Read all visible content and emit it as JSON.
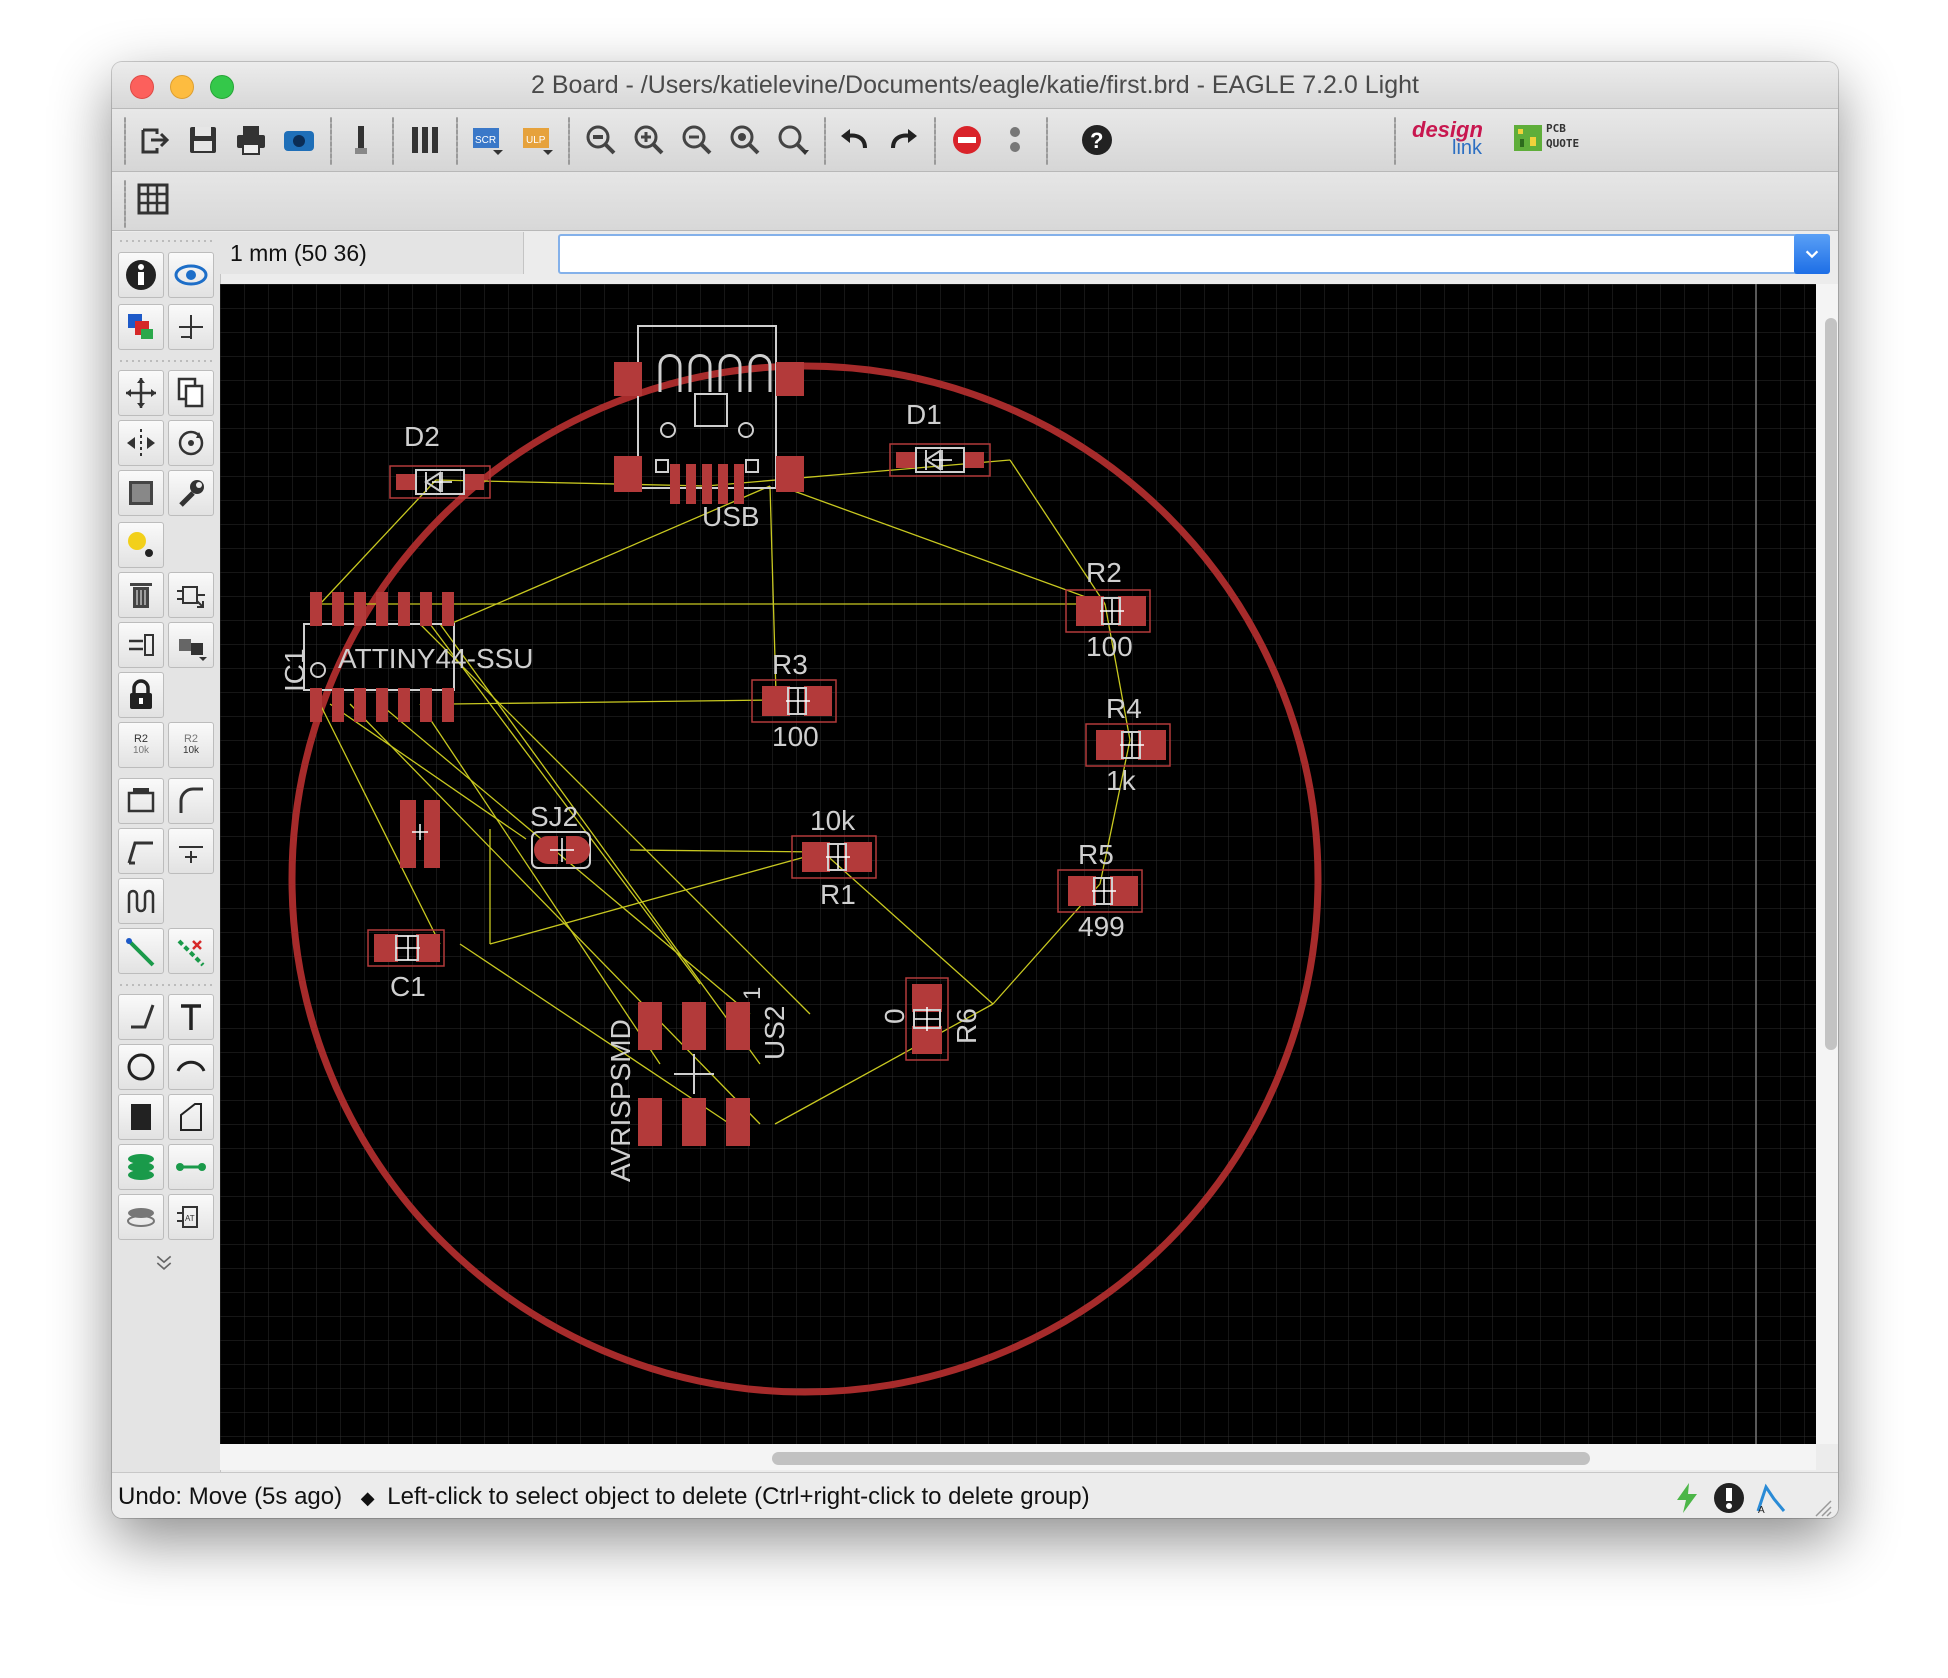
{
  "window": {
    "title": "2 Board - /Users/katielevine/Documents/eagle/katie/first.brd - EAGLE 7.2.0 Light"
  },
  "toolbar": {
    "icons": [
      "open-icon",
      "save-icon",
      "print-icon",
      "cam-icon",
      "export-icon",
      "library-icon",
      "script-icon",
      "ulp-icon",
      "zoom-fit-icon",
      "zoom-in-icon",
      "zoom-out-icon",
      "zoom-select-icon",
      "zoom-redraw-icon",
      "undo-icon",
      "redo-icon",
      "stop-icon",
      "go-icon",
      "help-icon"
    ],
    "brand_design": "design",
    "brand_link": "link",
    "pcb_quote_line1": "PCB",
    "pcb_quote_line2": "QUOTE"
  },
  "coord_display": "1 mm (50 36)",
  "command_line": {
    "value": "",
    "placeholder": ""
  },
  "left_tools": {
    "name_value_button_1_top": "R2",
    "name_value_button_1_bottom": "10k",
    "name_value_button_2_top": "R2",
    "name_value_button_2_bottom": "10k"
  },
  "board": {
    "labels": {
      "usb": "USB",
      "d1": "D1",
      "d2": "D2",
      "ic1_name": "IC1",
      "ic1_value": "ATTINY44-SSU",
      "r2": "R2",
      "r2_value": "100",
      "r3": "R3",
      "r3_value": "100",
      "r4": "R4",
      "r4_value": "1k",
      "r5": "R5",
      "r5_value": "499",
      "r1": "R1",
      "r1_value": "10k",
      "sj2": "SJ2",
      "c1": "C1",
      "r6": "R6",
      "r6_value": "0",
      "us2": "US2",
      "us2_pin": "1",
      "avr": "AVRISPSMD"
    },
    "colors": {
      "background": "#000000",
      "grid": "#2b2b2b",
      "outline": "#a32a2a",
      "pad": "#b33a3a",
      "airwire": "#c8c820",
      "silk": "#cfcfcf"
    }
  },
  "status": {
    "undo_text": "Undo: Move (5s ago)",
    "message": "Left-click to select object to delete (Ctrl+right-click to delete group)"
  }
}
